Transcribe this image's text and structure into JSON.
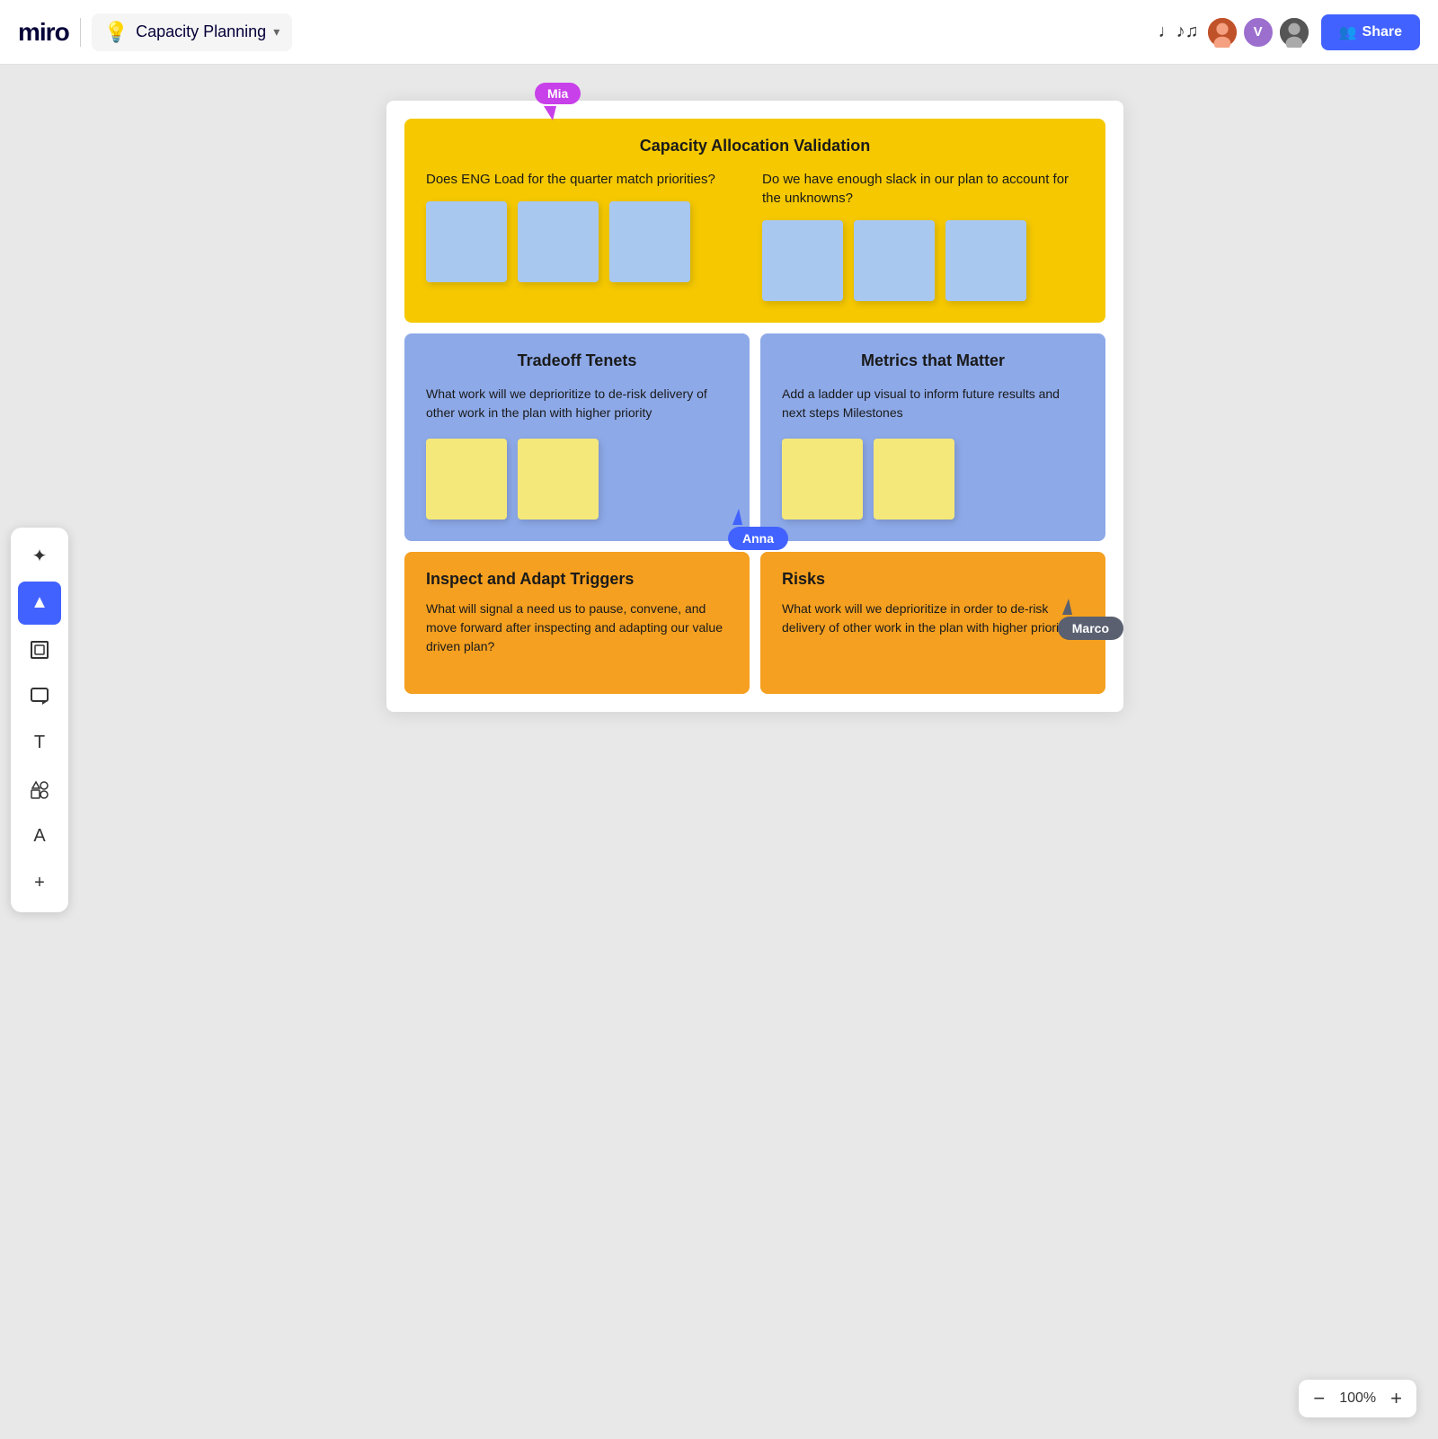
{
  "app": {
    "logo": "miro",
    "board_title": "Capacity Planning",
    "chevron": "▾",
    "bulb": "💡"
  },
  "header": {
    "music_symbol": "♩♪♫",
    "share_label": "Share",
    "share_icon": "👥"
  },
  "toolbar": {
    "tools": [
      {
        "name": "magic-icon",
        "label": "✦",
        "active": false
      },
      {
        "name": "cursor-icon",
        "label": "▲",
        "active": true
      },
      {
        "name": "frames-icon",
        "label": "⊞",
        "active": false
      },
      {
        "name": "sticky-icon",
        "label": "⌐",
        "active": false
      },
      {
        "name": "text-icon",
        "label": "T",
        "active": false
      },
      {
        "name": "shapes-icon",
        "label": "⬚",
        "active": false
      },
      {
        "name": "font-icon",
        "label": "A",
        "active": false
      },
      {
        "name": "add-icon",
        "label": "+",
        "active": false
      }
    ]
  },
  "board": {
    "sections": {
      "capacity_allocation": {
        "title": "Capacity Allocation Validation",
        "col1_question": "Does ENG Load for the quarter match priorities?",
        "col2_question": "Do we have enough slack in our plan to account for the unknowns?",
        "stickies_col1": 3,
        "stickies_col2": 3
      },
      "tradeoff": {
        "title": "Tradeoff Tenets",
        "body": "What work will we deprioritize to de-risk delivery of other work in the plan with higher priority",
        "stickies": 2
      },
      "metrics": {
        "title": "Metrics that Matter",
        "body": "Add a ladder up visual to inform future results and next steps Milestones",
        "stickies": 2
      },
      "inspect": {
        "title": "Inspect and Adapt Triggers",
        "body": "What will signal a need us to pause, convene, and move forward after inspecting and adapting our value driven plan?"
      },
      "risks": {
        "title": "Risks",
        "body": "What work will we deprioritize in order to de-risk delivery of other work in the plan with higher priority"
      }
    },
    "cursors": {
      "mia": "Mia",
      "anna": "Anna",
      "marco": "Marco"
    }
  },
  "zoom": {
    "level": "100%",
    "minus": "−",
    "plus": "+"
  }
}
